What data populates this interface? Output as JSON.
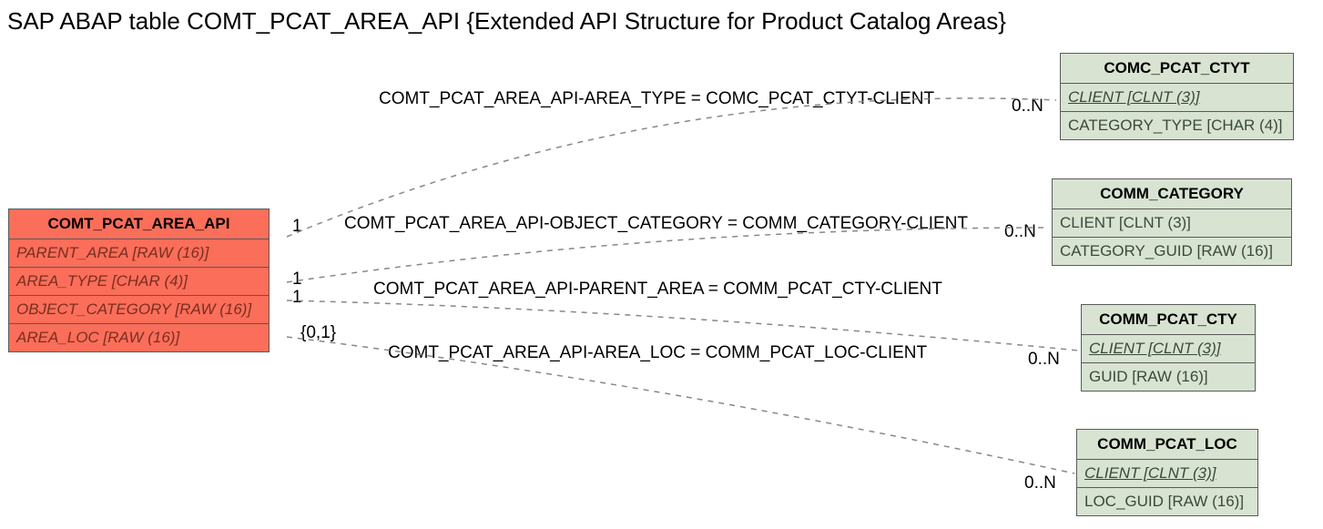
{
  "title": "SAP ABAP table COMT_PCAT_AREA_API {Extended API Structure for Product Catalog Areas}",
  "source_entity": {
    "name": "COMT_PCAT_AREA_API",
    "fields": [
      "PARENT_AREA [RAW (16)]",
      "AREA_TYPE [CHAR (4)]",
      "OBJECT_CATEGORY [RAW (16)]",
      "AREA_LOC [RAW (16)]"
    ]
  },
  "targets": [
    {
      "name": "COMC_PCAT_CTYT",
      "fields": [
        {
          "label": "CLIENT [CLNT (3)]",
          "fk": true
        },
        {
          "label": "CATEGORY_TYPE [CHAR (4)]",
          "fk": false
        }
      ]
    },
    {
      "name": "COMM_CATEGORY",
      "fields": [
        {
          "label": "CLIENT [CLNT (3)]",
          "fk": false
        },
        {
          "label": "CATEGORY_GUID [RAW (16)]",
          "fk": false
        }
      ]
    },
    {
      "name": "COMM_PCAT_CTY",
      "fields": [
        {
          "label": "CLIENT [CLNT (3)]",
          "fk": true
        },
        {
          "label": "GUID [RAW (16)]",
          "fk": false
        }
      ]
    },
    {
      "name": "COMM_PCAT_LOC",
      "fields": [
        {
          "label": "CLIENT [CLNT (3)]",
          "fk": true
        },
        {
          "label": "LOC_GUID [RAW (16)]",
          "fk": false
        }
      ]
    }
  ],
  "relations": [
    {
      "label": "COMT_PCAT_AREA_API-AREA_TYPE = COMC_PCAT_CTYT-CLIENT",
      "src_card": "1",
      "tgt_card": "0..N"
    },
    {
      "label": "COMT_PCAT_AREA_API-OBJECT_CATEGORY = COMM_CATEGORY-CLIENT",
      "src_card": "1",
      "tgt_card": "0..N"
    },
    {
      "label": "COMT_PCAT_AREA_API-PARENT_AREA = COMM_PCAT_CTY-CLIENT",
      "src_card": "1",
      "tgt_card": "0..N"
    },
    {
      "label": "COMT_PCAT_AREA_API-AREA_LOC = COMM_PCAT_LOC-CLIENT",
      "src_card": "{0,1}",
      "tgt_card": "0..N"
    }
  ]
}
